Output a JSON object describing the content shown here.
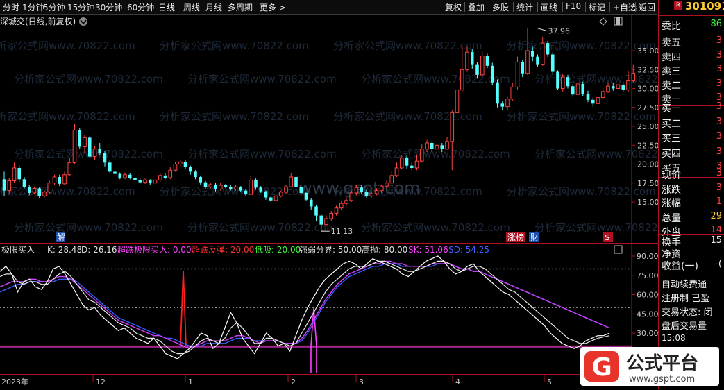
{
  "toolbar": {
    "left_items": [
      "分时",
      "1分钟",
      "5分钟",
      "15分钟",
      "30分钟",
      "60分钟",
      "日线",
      "周线",
      "月线",
      "多周期",
      "更多 >"
    ],
    "right_items": [
      "复权",
      "叠加",
      "多股",
      "统计",
      "画线",
      "F10",
      "标记",
      "+自选",
      "返回"
    ]
  },
  "stock": {
    "code": "301091",
    "badge": "R"
  },
  "price_chart": {
    "title": "深城交(日线,前复权)",
    "y_ticks": [
      "35.00",
      "32.50",
      "30.00",
      "27.50",
      "25.00",
      "22.50",
      "20.00",
      "17.50",
      "15.00"
    ],
    "y_values": [
      35,
      32.5,
      30,
      27.5,
      25,
      22.5,
      20,
      17.5,
      15
    ],
    "high_marker": "37.96",
    "low_marker": "11.13",
    "watermark_center": "www.gspt.com",
    "watermark_tile": "分析家公式网www.70822.com",
    "event_tags": [
      "解",
      "涨榜",
      "财",
      "$"
    ]
  },
  "indicator": {
    "name": "极限买入",
    "params": [
      {
        "label": "K: 28.48",
        "color": "#e0e0e0"
      },
      {
        "label": "D: 26.16",
        "color": "#e0e0e0"
      },
      {
        "label": "超跌极限买入: 0.00",
        "color": "#ff40ff"
      },
      {
        "label": "超跌反弹: 20.00",
        "color": "#ff3030"
      },
      {
        "label": "低吸: 20.00",
        "color": "#40ff40"
      },
      {
        "label": "强弱分界: 50.00",
        "color": "#e0e0e0"
      },
      {
        "label": "高抛: 80.00",
        "color": "#e0e0e0"
      },
      {
        "label": "SK: 51.06",
        "color": "#ff40ff"
      },
      {
        "label": "SD: 54.25",
        "color": "#4060ff"
      }
    ],
    "y_ticks": [
      "90.00",
      "75.00",
      "60.00",
      "45.00",
      "30.00"
    ]
  },
  "date_axis": [
    "2023年",
    "12",
    "1",
    "2",
    "3",
    "4",
    "5"
  ],
  "right_panel": {
    "weibi_label": "委比",
    "weibi_value": "-86",
    "sell": [
      "卖五",
      "卖四",
      "卖三",
      "卖二",
      "卖一"
    ],
    "buy": [
      "买一",
      "买二",
      "买三",
      "买四",
      "买五"
    ],
    "book_values": [
      "3",
      "3",
      "3",
      "3",
      "3",
      "3",
      "3",
      "3",
      "3",
      "3"
    ],
    "quote_labels": [
      "现价",
      "涨跌",
      "涨幅",
      "总量",
      "外盘"
    ],
    "quote_values": [
      "3",
      "3",
      "1",
      "29",
      "14"
    ],
    "extra_labels": [
      "换手",
      "净资",
      "收益(一)"
    ],
    "extra_values": [
      "15",
      "",
      "-("
    ],
    "notes": [
      "自动续费通",
      "注册制 已盈",
      "交易状态: 闭",
      "盘后交易量"
    ],
    "time": "15:08"
  },
  "logo": {
    "text": "公式平台",
    "url": "www.gspt.com",
    "letter": "G"
  },
  "colors": {
    "up": "#ff4444",
    "down": "#54ffff",
    "axis_red": "#b01020",
    "ma_blue": "#4060ff",
    "ma_magenta": "#ff40ff"
  }
}
